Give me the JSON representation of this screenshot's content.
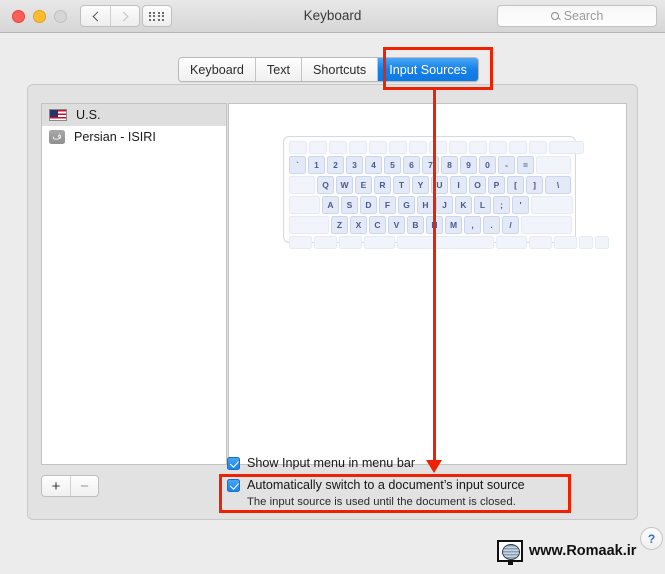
{
  "window": {
    "title": "Keyboard",
    "traffic_lights": [
      "close",
      "minimize",
      "zoom"
    ],
    "nav": {
      "back_icon": "chevron-left-icon",
      "forward_icon": "chevron-right-icon"
    },
    "grid_button": "show-all-preferences-icon"
  },
  "search": {
    "placeholder": "Search",
    "icon": "search-icon"
  },
  "tabs": [
    {
      "label": "Keyboard",
      "active": false
    },
    {
      "label": "Text",
      "active": false
    },
    {
      "label": "Shortcuts",
      "active": false
    },
    {
      "label": "Input Sources",
      "active": true
    }
  ],
  "input_sources": [
    {
      "name": "U.S.",
      "icon": "us-flag-icon",
      "selected": true
    },
    {
      "name": "Persian - ISIRI",
      "icon": "persian-letter-icon",
      "glyph": "ف",
      "selected": false
    }
  ],
  "list_buttons": {
    "add": "+",
    "remove": "−"
  },
  "keyboard_preview": {
    "rows": [
      [
        "",
        "",
        "",
        "",
        "",
        "",
        "",
        "",
        "",
        "",
        "",
        "",
        "",
        ""
      ],
      [
        "`",
        "1",
        "2",
        "3",
        "4",
        "5",
        "6",
        "7",
        "8",
        "9",
        "0",
        "-",
        "=",
        ""
      ],
      [
        "",
        "Q",
        "W",
        "E",
        "R",
        "T",
        "Y",
        "U",
        "I",
        "O",
        "P",
        "[",
        "]",
        "\\"
      ],
      [
        "",
        "A",
        "S",
        "D",
        "F",
        "G",
        "H",
        "J",
        "K",
        "L",
        ";",
        "'",
        ""
      ],
      [
        "",
        "Z",
        "X",
        "C",
        "V",
        "B",
        "N",
        "M",
        ",",
        ".",
        "/",
        ""
      ],
      [
        "",
        "",
        "",
        "",
        "",
        "",
        "",
        "",
        "",
        ""
      ]
    ]
  },
  "options": {
    "show_input_menu": {
      "label": "Show Input menu in menu bar",
      "checked": true
    },
    "auto_switch": {
      "label": "Automatically switch to a document’s input source",
      "sublabel": "The input source is used until the document is closed.",
      "checked": true
    }
  },
  "help": {
    "label": "?"
  },
  "watermark": {
    "text": "www.Romaak.ir",
    "icon": "globe-monitor-icon"
  },
  "annotations": {
    "accent_color": "#ee2200",
    "boxes": [
      "input-sources-tab",
      "auto-switch-option"
    ],
    "arrow": "tab-to-auto-switch"
  },
  "colors": {
    "selected_tab": "#1480e8",
    "checkbox": "#1886ea",
    "key_text": "#4a5a8e",
    "annotation": "#ee2200"
  }
}
